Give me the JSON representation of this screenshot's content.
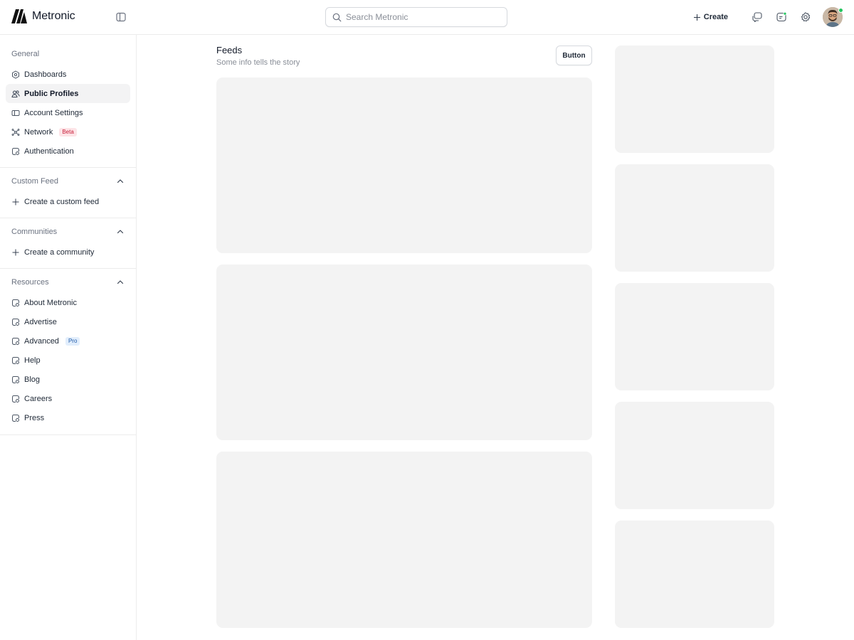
{
  "app": {
    "name": "Metronic"
  },
  "search": {
    "placeholder": "Search Metronic"
  },
  "header": {
    "create_label": "Create"
  },
  "sidebar": {
    "general": {
      "title": "General",
      "items": [
        {
          "label": "Dashboards",
          "icon": "dashboard-icon"
        },
        {
          "label": "Public Profiles",
          "icon": "users-icon",
          "active": true
        },
        {
          "label": "Account Settings",
          "icon": "settings-card-icon"
        },
        {
          "label": "Network",
          "icon": "network-icon",
          "badge": "Beta"
        },
        {
          "label": "Authentication",
          "icon": "shield-icon"
        }
      ]
    },
    "custom_feed": {
      "title": "Custom Feed",
      "action": "Create a custom feed"
    },
    "communities": {
      "title": "Communities",
      "action": "Create a community"
    },
    "resources": {
      "title": "Resources",
      "items": [
        {
          "label": "About Metronic"
        },
        {
          "label": "Advertise"
        },
        {
          "label": "Advanced",
          "badge": "Pro"
        },
        {
          "label": "Help"
        },
        {
          "label": "Blog"
        },
        {
          "label": "Careers"
        },
        {
          "label": "Press"
        }
      ]
    }
  },
  "main": {
    "title": "Feeds",
    "subtitle": "Some info tells the story",
    "button_label": "Button"
  },
  "colors": {
    "placeholder": "#f3f3f3",
    "border": "#ececec",
    "online": "#22c55e",
    "beta_badge": "#fde4e7",
    "pro_badge": "#e2eefc"
  }
}
